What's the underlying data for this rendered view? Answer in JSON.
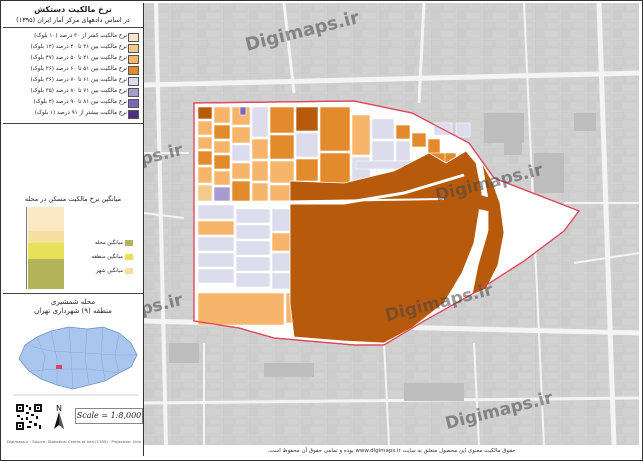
{
  "legend": {
    "title": "نرخ مالکیت دستکش",
    "subtitle": "در اساس دادههای مرکز آمار ایران (۱۳۹۵)",
    "items": [
      {
        "label": "نرخ مالکیت کمتر از ۳۰ درصد (۱۰ بلوک)",
        "color": "#f6e6c9"
      },
      {
        "label": "نرخ مالکیت بین ۳۱ تا ۴۰ درصد (۱۲ بلوک)",
        "color": "#f3c98c"
      },
      {
        "label": "نرخ مالکیت بین ۴۱ تا ۵۰ درصد (۴۷ بلوک)",
        "color": "#f6b56a"
      },
      {
        "label": "نرخ مالکیت بین ۵۱ تا ۶۰ درصد (۲۶ بلوک)",
        "color": "#e38b2c"
      },
      {
        "label": "نرخ مالکیت بین ۶۱ تا ۷۰ درصد (۳۶ بلوک)",
        "color": "#dcdcec"
      },
      {
        "label": "نرخ مالکیت بین ۷۱ تا ۸۰ درصد (۳۵ بلوک)",
        "color": "#a79ad0"
      },
      {
        "label": "نرخ مالکیت بین ۸۱ تا ۹۰ درصد (۲ بلوک)",
        "color": "#7b67b8"
      },
      {
        "label": "نرخ مالکیت بیشتر از ۹۱ درصد (۱ بلوک)",
        "color": "#4d2f84"
      }
    ]
  },
  "bars": {
    "title": "میانگین نرخ مالکیت مسکن در محله",
    "legend": [
      {
        "label": "میانگین محله",
        "color": "#b3b35a"
      },
      {
        "label": "میانگین منطقه",
        "color": "#e6e05a"
      },
      {
        "label": "میانگین شهر",
        "color": "#f7df9f"
      }
    ]
  },
  "location": {
    "line1": "محله شمشیری",
    "line2": "منطقه (۹) شهرداری تهران"
  },
  "scale": "Scale = 1:8,000",
  "north_label": "N",
  "credit": "Digimaps.ir · Source: Statistical Centre of Iran (1395) · Projection: Universal Transverse Mercator",
  "watermark": "Digimaps.ir",
  "footer": "حقوق مالکیت معنوی این محصول متعلق به سایت www.digimaps.ir بوده و تمامی حقوق آن محفوظ است.",
  "colors": {
    "map_bg": "#d9d9d9",
    "road": "#ffffff",
    "boundary": "#e0455a",
    "big_block": "#b85a0c"
  }
}
